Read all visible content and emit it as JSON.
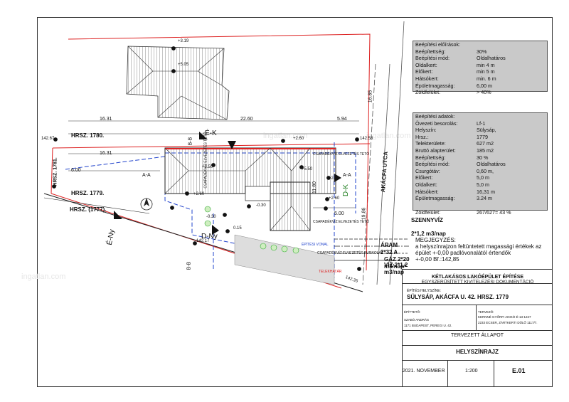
{
  "watermark": "ingatlan.com",
  "regulations": {
    "title": "Beépítési előírások:",
    "rows": [
      {
        "k": "Beépítettség:",
        "v": "30%"
      },
      {
        "k": "Beépítési mód:",
        "v": "Oldalhatáros"
      },
      {
        "k": "Oldalkert:",
        "v": "min 4 m"
      },
      {
        "k": "Előkert:",
        "v": "min 5 m"
      },
      {
        "k": "Hátsókert:",
        "v": "min. 6 m"
      },
      {
        "k": "Épületmagasság:",
        "v": "6,00 m"
      },
      {
        "k": "Zöldfelület:",
        "v": "> 40%"
      }
    ]
  },
  "data": {
    "title": "Beépítési adatok:",
    "rows": [
      {
        "k": "Övezeti besorolás:",
        "v": "Lf-1"
      },
      {
        "k": "Helyszín:",
        "v": "Sülysáp,"
      },
      {
        "k": "Hrsz.:",
        "v": "1779"
      },
      {
        "k": "Telekterülete:",
        "v": "627 m2"
      },
      {
        "k": "Bruttó alapterület:",
        "v": "185 m2"
      },
      {
        "k": "Beépítettség:",
        "v": "30 %"
      },
      {
        "k": "Beépítési mód:",
        "v": "Oldalhatáros"
      },
      {
        "k": "Csurgótáv:",
        "v": "0,60 m,"
      },
      {
        "k": "Előkert:",
        "v": "5,0 m"
      },
      {
        "k": "Oldalkert:",
        "v": "5,0 m"
      },
      {
        "k": "Hátsókert:",
        "v": "16,31 m"
      },
      {
        "k": "Épületmagasság:",
        "v": "3.24 m"
      }
    ],
    "green_k": "Zöldfelület:",
    "green_v": "267/627= 43 %"
  },
  "labels": {
    "street": "AKÁCFA UTCA",
    "hrsz1780": "HRSZ. 1780.",
    "hrsz1779": "HRSZ. 1779.",
    "hrsz1777": "HRSZ. (1777).",
    "hrsz1781": "HRSZ. 1781.",
    "ek": "É-K",
    "ek2": "É-K",
    "eny": "É-Ny",
    "dny": "D-Ny",
    "dk": "D-K",
    "aa1": "A-A",
    "aa2": "A-A",
    "bb1": "B-B",
    "bb2": "B-B",
    "d1": "16.31",
    "d2": "22.60",
    "d3": "5.94",
    "d4": "16.31",
    "d5": "6.00",
    "d6": "11.80",
    "d7": "5.00",
    "d8": "16.85",
    "d9": "19.86",
    "d10": "142.67",
    "d11": "142.58",
    "d12": "142.35",
    "d13": "142.17",
    "e1": "+3.19",
    "e2": "+5.05",
    "e3": "+2.60",
    "e4": "+5.50",
    "e5": "+5.50",
    "e6": "+2.60",
    "e7": "+2.60",
    "e8": "-0.30",
    "e9": "-0.30",
    "e10": "0.15",
    "e11": "+2.60",
    "roof1": "CSAPADÉKVÍZ ELVEZETÉS TETŐ",
    "roof2": "CSAPADÉKVÍZ ELVEZETÉS TETŐ",
    "roof3": "CSAPADÉKVÍZ ELVEZETÉS TETŐ",
    "roof4": "CSAPADÉKVÍZ ELVEZETÉS BURKOLAT",
    "build_line": "ÉPÍTÉSI VONAL",
    "boundary": "TELEKHATÁR",
    "sewer_title": "SZENNYVÍZ",
    "sewer_val": "2*1,2 m3/nap",
    "power_title": "ÁRAM",
    "power_val": "2*32 A",
    "gas_title": "GÁZ 2*20",
    "gas_val": "m3/nap*",
    "water_title": "VÍZ 2*1,2",
    "water_val": "m3/nap",
    "remark_title": "MEGJEGYZÉS:",
    "remark_1": "a helyszínrajzon feltüntetett magassági értékek az",
    "remark_2": "épület +-0,00 padlóvonalától értendők",
    "remark_3": "+-0,00 Bf.:142,85"
  },
  "title_block": {
    "project_title": "KÉTLAKÁSOS LAKÓÉPÜLET ÉPÍTÉSE",
    "project_sub": "EGYSZERŰSÍTETT KIVITELEZÉSI DOKUMENTÁCIÓ",
    "site_label": "ÉPÍTÉS HELYSZÍNE:",
    "site_value": "SÜLYSÁP, AKÁCFA U. 42. HRSZ. 1779",
    "client_label": "ÉPÍTTETŐ:",
    "client_name": "SZABÓ ANDRÁS",
    "client_addr": "1171 BUDAPEST, PEREGI U. 42.",
    "designer_label": "TERVEZŐ:",
    "designer_name": "KERNNÉ GYŐRFI ANIKÓ É-13-1227",
    "designer_addr": "2233 ECSER, ZÁRTKERTI DŰLŐ 1117/7.",
    "state": "TERVEZETT ÁLLAPOT",
    "drawing": "HELYSZÍNRAJZ",
    "date": "2021. NOVEMBER",
    "scale": "1:200",
    "sheet": "E.01"
  }
}
